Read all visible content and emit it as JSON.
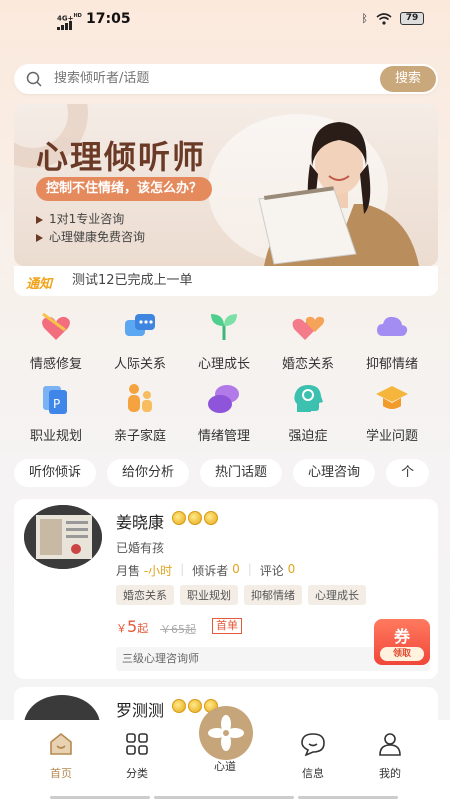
{
  "status_bar": {
    "network": "4G+",
    "hd": "HD",
    "time": "17:05",
    "battery": "79"
  },
  "search": {
    "placeholder": "搜索倾听者/话题",
    "button_label": "搜索"
  },
  "banner": {
    "title": "心理倾听师",
    "pill": "控制不住情绪，该怎么办？",
    "points": [
      "1对1专业咨询",
      "心理健康免费咨询"
    ]
  },
  "notice": {
    "tag": "通知",
    "text": "测试12已完成上一单"
  },
  "categories": [
    {
      "label": "情感修复",
      "icon": "heart-arrow-icon"
    },
    {
      "label": "人际关系",
      "icon": "chat-bubbles-icon"
    },
    {
      "label": "心理成长",
      "icon": "sprout-icon"
    },
    {
      "label": "婚恋关系",
      "icon": "hearts-icon"
    },
    {
      "label": "抑郁情绪",
      "icon": "cloud-icon"
    },
    {
      "label": "职业规划",
      "icon": "document-icon"
    },
    {
      "label": "亲子家庭",
      "icon": "family-icon"
    },
    {
      "label": "情绪管理",
      "icon": "mood-bubbles-icon"
    },
    {
      "label": "强迫症",
      "icon": "head-brain-icon"
    },
    {
      "label": "学业问题",
      "icon": "graduation-cap-icon"
    }
  ],
  "chips": [
    "听你倾诉",
    "给你分析",
    "热门话题",
    "心理咨询",
    "个"
  ],
  "listeners": [
    {
      "name": "姜晓康",
      "sub": "已婚有孩",
      "sales_label": "月售",
      "sales_value": "-小时",
      "listeners_label": "倾诉者",
      "listeners_value": "0",
      "reviews_label": "评论",
      "reviews_value": "0",
      "tags": [
        "婚恋关系",
        "职业规划",
        "抑郁情绪",
        "心理成长"
      ],
      "price_symbol": "￥",
      "price": "5",
      "price_unit": "起",
      "old_price": "￥65起",
      "first_order": "首单",
      "title": "三级心理咨询师",
      "coupon_top": "券",
      "coupon_bottom": "领取"
    },
    {
      "name": "罗测测"
    }
  ],
  "tabbar": [
    {
      "label": "首页",
      "icon": "home-icon",
      "active": true
    },
    {
      "label": "分类",
      "icon": "grid-icon",
      "active": false
    },
    {
      "label": "心道",
      "icon": "pinwheel-icon",
      "active": false
    },
    {
      "label": "信息",
      "icon": "message-icon",
      "active": false
    },
    {
      "label": "我的",
      "icon": "user-icon",
      "active": false
    }
  ],
  "colors": {
    "accent": "#c9a97b",
    "price": "#e55a3a",
    "stat_highlight": "#e5a21e",
    "active_tab": "#b58a52"
  }
}
